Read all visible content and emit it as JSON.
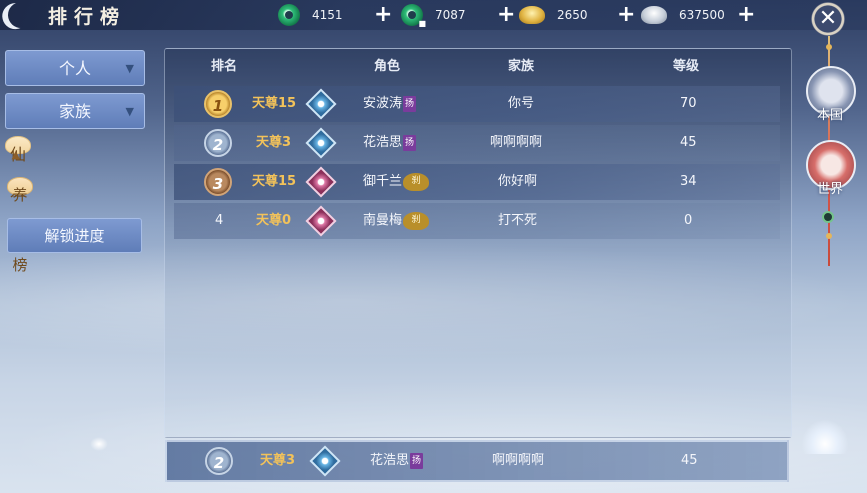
{
  "header": {
    "title": "排行榜",
    "currencies": [
      {
        "icon": "jade-icon",
        "value": "4151"
      },
      {
        "icon": "bound-jade-icon",
        "value": "7087"
      },
      {
        "icon": "gold-ingot-icon",
        "value": "2650"
      },
      {
        "icon": "silver-ingot-icon",
        "value": "637500"
      }
    ],
    "plus": "+",
    "close": "✕"
  },
  "menu": {
    "personal": "个人",
    "clan": "家族",
    "fairy": "仙姬",
    "cultivation": "养成榜",
    "unlock": "解锁进度",
    "collapsed_arrow": "▼",
    "expanded_arrow": "▲"
  },
  "table": {
    "headers": {
      "rank": "排名",
      "role": "角色",
      "clan": "家族",
      "level": "等级"
    },
    "rows": [
      {
        "rank": "1",
        "tier": "天尊15",
        "class_icon": "blue-diamond-icon",
        "name": "安波涛",
        "tag": "扬",
        "clan": "你号",
        "level": "70"
      },
      {
        "rank": "2",
        "tier": "天尊3",
        "class_icon": "blue-diamond-icon",
        "name": "花浩思",
        "tag": "扬",
        "clan": "啊啊啊啊",
        "level": "45"
      },
      {
        "rank": "3",
        "tier": "天尊15",
        "class_icon": "pink-diamond-icon",
        "name": "御千兰",
        "tag": "刹",
        "clan": "你好啊",
        "level": "34"
      },
      {
        "rank": "4",
        "tier": "天尊0",
        "class_icon": "pink-diamond-icon",
        "name": "南曼梅",
        "tag": "刹",
        "clan": "打不死",
        "level": "0"
      }
    ]
  },
  "self_row": {
    "rank": "2",
    "tier": "天尊3",
    "class_icon": "blue-diamond-icon",
    "name": "花浩思",
    "tag": "扬",
    "clan": "啊啊啊啊",
    "level": "45"
  },
  "right_nav": {
    "local": "本国",
    "world": "世界"
  }
}
